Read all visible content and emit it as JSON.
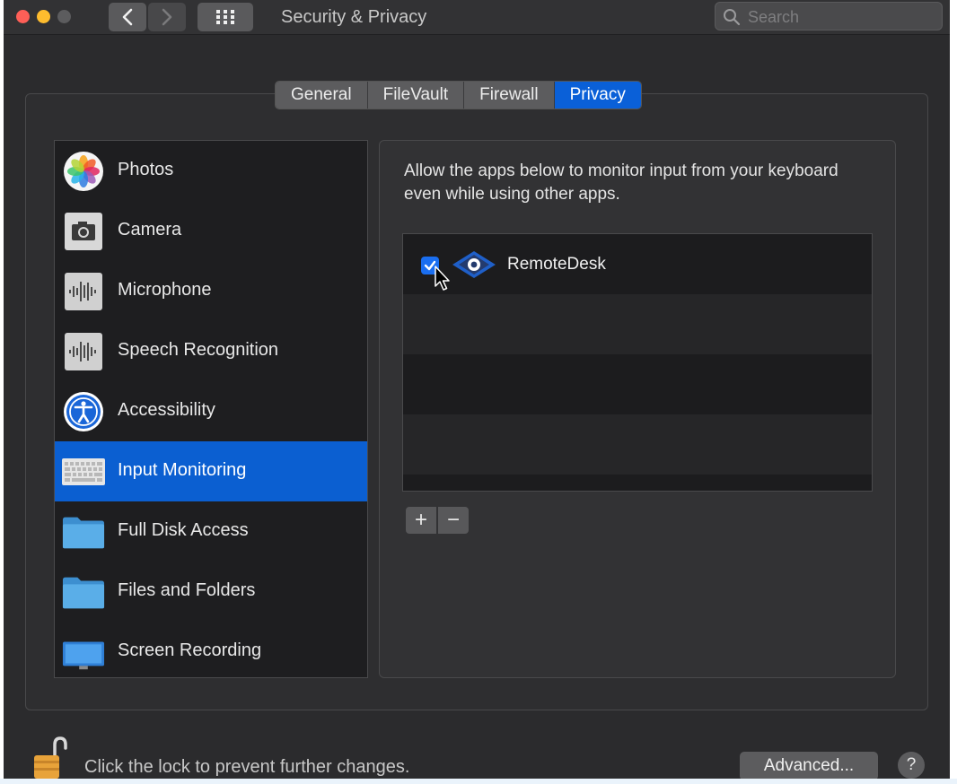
{
  "window": {
    "title": "Security & Privacy",
    "search_placeholder": "Search"
  },
  "tabs": [
    {
      "label": "General",
      "active": false
    },
    {
      "label": "FileVault",
      "active": false
    },
    {
      "label": "Firewall",
      "active": false
    },
    {
      "label": "Privacy",
      "active": true
    }
  ],
  "sidebar": {
    "items": [
      {
        "label": "Photos",
        "icon": "photos-icon",
        "selected": false
      },
      {
        "label": "Camera",
        "icon": "camera-icon",
        "selected": false
      },
      {
        "label": "Microphone",
        "icon": "microphone-icon",
        "selected": false
      },
      {
        "label": "Speech Recognition",
        "icon": "speech-recognition-icon",
        "selected": false
      },
      {
        "label": "Accessibility",
        "icon": "accessibility-icon",
        "selected": false
      },
      {
        "label": "Input Monitoring",
        "icon": "keyboard-icon",
        "selected": true
      },
      {
        "label": "Full Disk Access",
        "icon": "folder-icon",
        "selected": false
      },
      {
        "label": "Files and Folders",
        "icon": "folder-icon",
        "selected": false
      },
      {
        "label": "Screen Recording",
        "icon": "display-icon",
        "selected": false
      }
    ]
  },
  "main": {
    "description": "Allow the apps below to monitor input from your keyboard even while using other apps.",
    "apps": [
      {
        "name": "RemoteDesk",
        "checked": true,
        "icon": "remotedesk-icon"
      }
    ],
    "add_label": "+",
    "remove_label": "−"
  },
  "footer": {
    "lock_text": "Click the lock to prevent further changes.",
    "advanced_label": "Advanced...",
    "help_label": "?"
  },
  "colors": {
    "accent": "#0a60d8",
    "window_bg": "#2b2b2d"
  }
}
